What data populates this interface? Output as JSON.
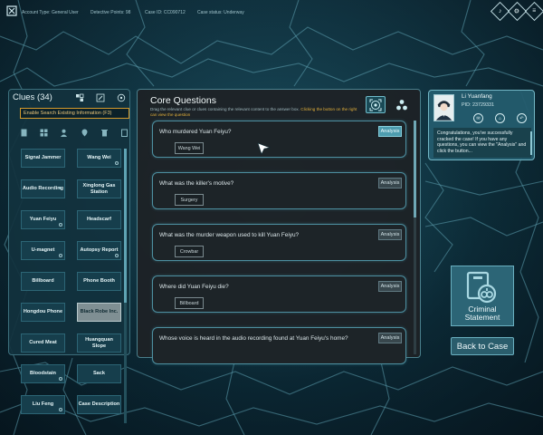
{
  "topbar": {
    "account_type": "Account Type: General User",
    "detective_points": "Detective Points: 98",
    "case_id": "Case ID: CC090712",
    "case_status": "Case status: Underway",
    "buttons": [
      {
        "icon": "sound-icon",
        "glyph": "♪"
      },
      {
        "icon": "settings-icon",
        "glyph": "⚙"
      },
      {
        "icon": "menu-icon",
        "glyph": "≡"
      }
    ]
  },
  "clues": {
    "title": "Clues",
    "count": "(34)",
    "search_placeholder": "Enable Search Existing Information (F3)",
    "filter_icons": [
      "document-icon",
      "grid-icon",
      "person-icon",
      "location-icon",
      "trash-icon",
      "clipboard-icon"
    ],
    "items": [
      {
        "label": "Signal Jammer",
        "selected": false,
        "badge": false
      },
      {
        "label": "Wang Wei",
        "selected": false,
        "badge": true
      },
      {
        "label": "Audio Recording",
        "selected": false,
        "badge": false,
        "dot": true
      },
      {
        "label": "Xinglong Gas Station",
        "selected": false,
        "badge": false
      },
      {
        "label": "Yuan Feiyu",
        "selected": false,
        "badge": true
      },
      {
        "label": "Headscarf",
        "selected": false,
        "badge": false
      },
      {
        "label": "U-magnet",
        "selected": false,
        "badge": true
      },
      {
        "label": "Autopsy Report",
        "selected": false,
        "badge": true
      },
      {
        "label": "Billboard",
        "selected": false,
        "badge": false
      },
      {
        "label": "Phone Booth",
        "selected": false,
        "badge": false
      },
      {
        "label": "Hongdou Phone",
        "selected": false,
        "badge": false
      },
      {
        "label": "Black Robe Inc.",
        "selected": true,
        "badge": false
      },
      {
        "label": "Cured Meat",
        "selected": false,
        "badge": false
      },
      {
        "label": "Huangquan Slope",
        "selected": false,
        "badge": false
      },
      {
        "label": "Bloodstain",
        "selected": false,
        "badge": true
      },
      {
        "label": "Sack",
        "selected": false,
        "badge": false
      },
      {
        "label": "Liu Feng",
        "selected": false,
        "badge": true
      },
      {
        "label": "Case Description",
        "selected": false,
        "badge": false
      }
    ]
  },
  "core": {
    "title": "Core Questions",
    "desc_main": "Drag the relevant clue or clues containing the relevant content to the answer box. ",
    "desc_highlight": "Clicking the button on the right can view the question",
    "questions": [
      {
        "text": "Who murdered Yuan Feiyu?",
        "answer": "Wang Wei",
        "button": "Analysis",
        "active": true
      },
      {
        "text": "What was the killer's motive?",
        "answer": "Surgery",
        "button": "Analysis",
        "active": false
      },
      {
        "text": "What was the murder weapon used to kill Yuan Feiyu?",
        "answer": "Crowbar",
        "button": "Analysis",
        "active": false
      },
      {
        "text": "Where did Yuan Feiyu die?",
        "answer": "Billboard",
        "button": "Analysis",
        "active": false
      },
      {
        "text": "Whose voice is heard in the audio recording found at Yuan Feiyu's home?",
        "answer": "",
        "button": "Analysis",
        "active": false
      }
    ]
  },
  "character": {
    "name": "Li Yuanfang",
    "pid": "PID: 23729331",
    "message": "Congratulations, you've successfully cracked the case! If you have any questions, you can view the \"Analysis\" and click the button...",
    "icons": [
      "message-icon",
      "home-icon",
      "back-icon"
    ]
  },
  "actions": {
    "statement_line1": "Criminal",
    "statement_line2": "Statement",
    "back": "Back to Case"
  }
}
